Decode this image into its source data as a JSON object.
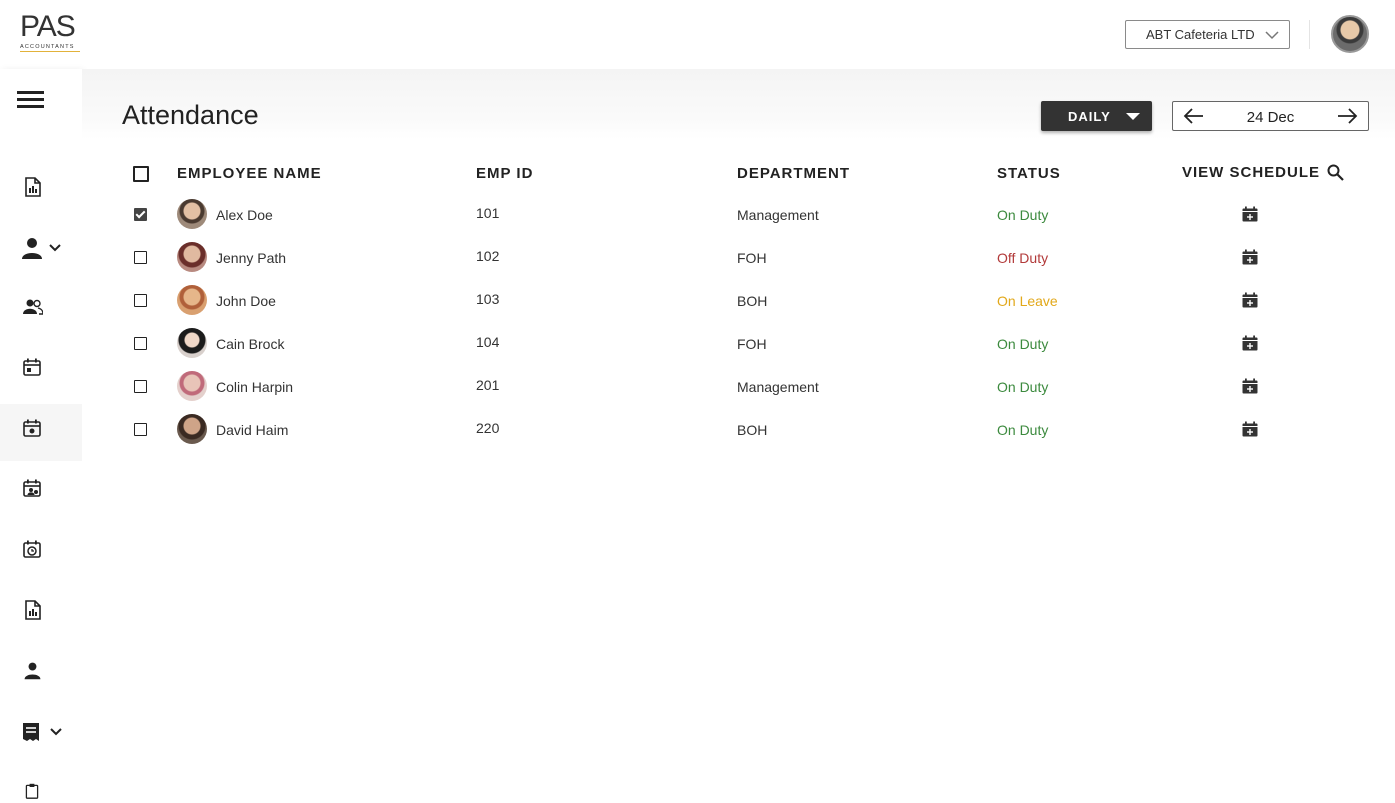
{
  "topbar": {
    "logo_main": "PAS",
    "logo_sub": "ACCOUNTANTS",
    "company": "ABT Cafeteria LTD"
  },
  "page": {
    "title": "Attendance",
    "period": "DAILY",
    "date": "24 Dec"
  },
  "table": {
    "columns": [
      "EMPLOYEE NAME",
      "EMP ID",
      "DEPARTMENT",
      "STATUS",
      "VIEW SCHEDULE"
    ],
    "rows": [
      {
        "name": "Alex Doe",
        "id": "101",
        "department": "Management",
        "status": "On Duty",
        "checked": true
      },
      {
        "name": "Jenny Path",
        "id": "102",
        "department": "FOH",
        "status": "Off Duty",
        "checked": false
      },
      {
        "name": "John Doe",
        "id": "103",
        "department": "BOH",
        "status": "On Leave",
        "checked": false
      },
      {
        "name": "Cain Brock",
        "id": "104",
        "department": "FOH",
        "status": "On Duty",
        "checked": false
      },
      {
        "name": "Colin Harpin",
        "id": "201",
        "department": "Management",
        "status": "On Duty",
        "checked": false
      },
      {
        "name": "David Haim",
        "id": "220",
        "department": "BOH",
        "status": "On Duty",
        "checked": false
      }
    ]
  },
  "colors": {
    "on_duty": "#3c8a3e",
    "off_duty": "#b23a3a",
    "on_leave": "#e2a81a",
    "logo_accent": "#e2b23a"
  },
  "icons": {
    "sidebar": [
      "menu-icon",
      "report-icon",
      "user-icon",
      "team-icon",
      "calendar-icon",
      "calendar-event-icon",
      "calendar-user-icon",
      "calendar-clock-icon",
      "report-icon",
      "user-icon",
      "receipt-icon",
      "clipboard-icon"
    ]
  }
}
